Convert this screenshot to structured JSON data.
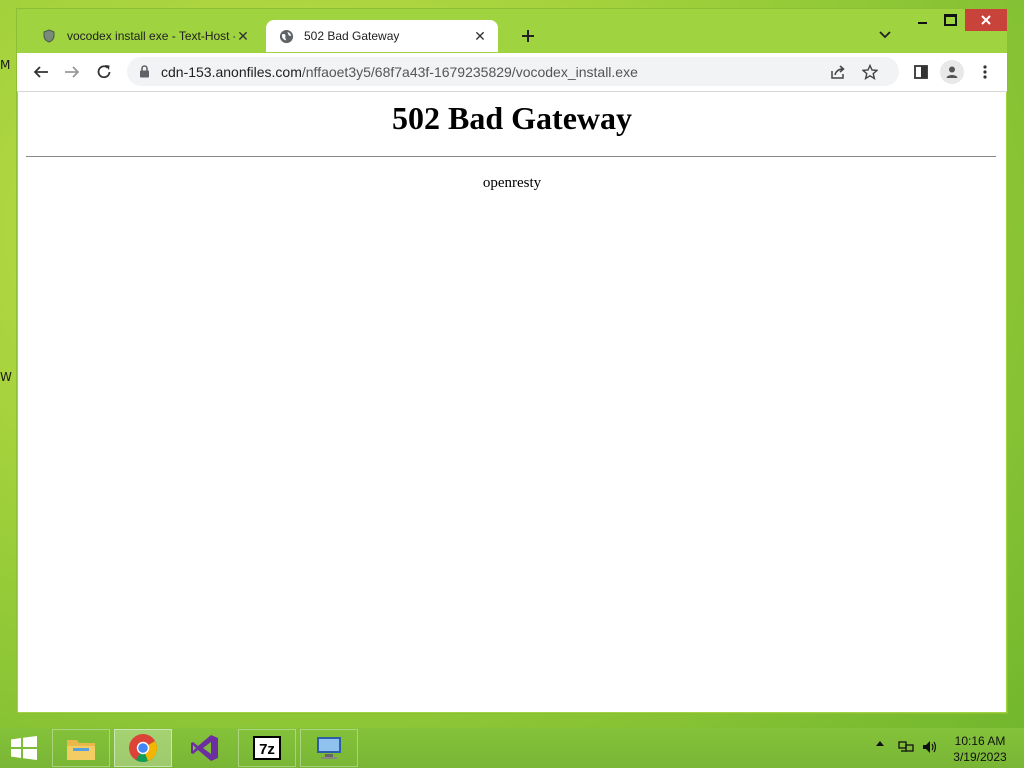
{
  "desktop": {
    "edge_glyph_top": "M",
    "edge_glyph_mid": "W"
  },
  "browser": {
    "tabs": [
      {
        "title": "vocodex install exe - Text-Host - ",
        "icon": "shield-icon",
        "active": false
      },
      {
        "title": "502 Bad Gateway",
        "icon": "globe-icon",
        "active": true
      }
    ],
    "address": {
      "host": "cdn-153.anonfiles.com",
      "path": "/nffaoet3y5/68f7a43f-1679235829/vocodex_install.exe"
    }
  },
  "page": {
    "heading": "502 Bad Gateway",
    "server": "openresty"
  },
  "taskbar": {
    "apps": [
      "File Explorer",
      "Google Chrome",
      "Visual Studio",
      "7-Zip",
      "Remote Desktop"
    ],
    "time": "10:16 AM",
    "date": "3/19/2023"
  },
  "colors": {
    "accent_close": "#c8433a",
    "desktop": "#9fd03b",
    "taskbar": "#7fbc37"
  }
}
